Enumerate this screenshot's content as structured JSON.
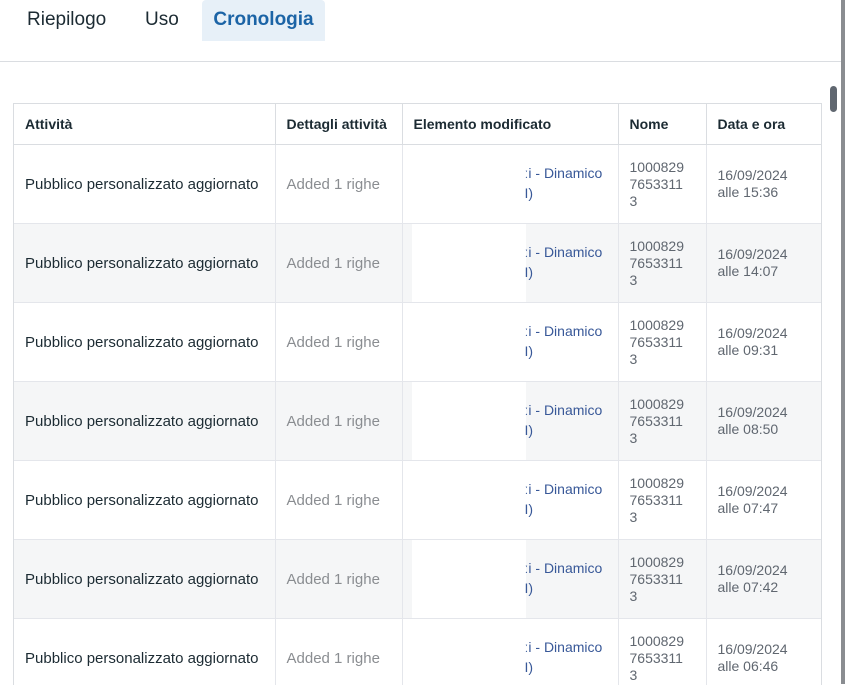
{
  "tabs": [
    {
      "label": "Riepilogo",
      "active": false
    },
    {
      "label": "Uso",
      "active": false
    },
    {
      "label": "Cronologia",
      "active": true
    }
  ],
  "table": {
    "headers": [
      "Attività",
      "Dettagli attività",
      "Elemento modificato",
      "Nome",
      "Data e ora"
    ],
    "rows": [
      {
        "attivita": "Pubblico personalizzato aggiornato",
        "dettagli": "Added 1 righe",
        "elemento_line1": "ːi - Dinamico",
        "elemento_line2": "I)",
        "nome": "1000829\n7653311\n3",
        "data": "16/09/2024\nalle 15:36"
      },
      {
        "attivita": "Pubblico personalizzato aggiornato",
        "dettagli": "Added 1 righe",
        "elemento_line1": "ːi - Dinamico",
        "elemento_line2": "I)",
        "nome": "1000829\n7653311\n3",
        "data": "16/09/2024\nalle 14:07"
      },
      {
        "attivita": "Pubblico personalizzato aggiornato",
        "dettagli": "Added 1 righe",
        "elemento_line1": "ːi - Dinamico",
        "elemento_line2": "I)",
        "nome": "1000829\n7653311\n3",
        "data": "16/09/2024\nalle 09:31"
      },
      {
        "attivita": "Pubblico personalizzato aggiornato",
        "dettagli": "Added 1 righe",
        "elemento_line1": "ːi - Dinamico",
        "elemento_line2": "I)",
        "nome": "1000829\n7653311\n3",
        "data": "16/09/2024\nalle 08:50"
      },
      {
        "attivita": "Pubblico personalizzato aggiornato",
        "dettagli": "Added 1 righe",
        "elemento_line1": "ːi - Dinamico",
        "elemento_line2": "I)",
        "nome": "1000829\n7653311\n3",
        "data": "16/09/2024\nalle 07:47"
      },
      {
        "attivita": "Pubblico personalizzato aggiornato",
        "dettagli": "Added 1 righe",
        "elemento_line1": "ːi - Dinamico",
        "elemento_line2": "I)",
        "nome": "1000829\n7653311\n3",
        "data": "16/09/2024\nalle 07:42"
      },
      {
        "attivita": "Pubblico personalizzato aggiornato",
        "dettagli": "Added 1 righe",
        "elemento_line1": "ːi - Dinamico",
        "elemento_line2": "I)",
        "nome": "1000829\n7653311\n3",
        "data": "16/09/2024\nalle 06:46"
      }
    ]
  },
  "colors": {
    "active_tab_bg": "#e7f0f8",
    "active_tab_text": "#1c64a6",
    "link": "#385898",
    "muted": "#8a8d91"
  }
}
